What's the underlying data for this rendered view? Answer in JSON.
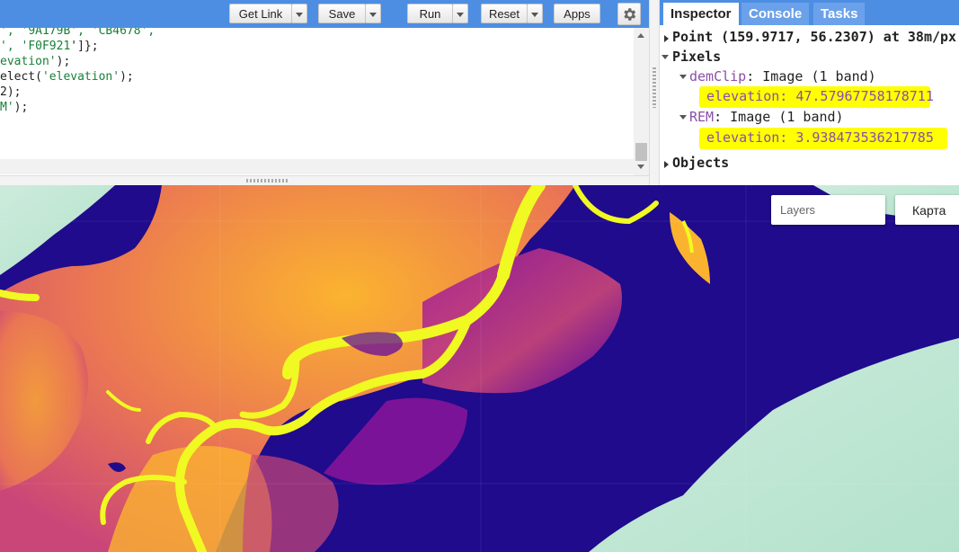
{
  "toolbar": {
    "get_link": "Get Link",
    "save": "Save",
    "run": "Run",
    "reset": "Reset",
    "apps": "Apps"
  },
  "code": {
    "line1_a": "', '",
    "line1_b": "9A179B",
    "line1_c": "', '",
    "line1_d": "CB4678",
    "line1_e": "',",
    "line2_a": "', '",
    "line2_b": "F0F921",
    "line2_c": "']};",
    "line3_a": "evation'",
    "line3_b": ");",
    "line4_a": "elect(",
    "line4_b": "'elevation'",
    "line4_c": ");",
    "line5": "2);",
    "line6_a": "M'",
    "line6_b": ");"
  },
  "tabs": {
    "inspector": "Inspector",
    "console": "Console",
    "tasks": "Tasks"
  },
  "inspector": {
    "point": "Point (159.9717, 56.2307) at 38m/px",
    "pixels": "Pixels",
    "dem_name": "demClip",
    "dem_desc": ": Image (1 band)",
    "dem_value": "elevation: 47.57967758178711",
    "rem_name": "REM",
    "rem_desc": ": Image (1 band)",
    "rem_value": "elevation: 3.938473536217785",
    "objects": "Objects"
  },
  "map": {
    "layers": "Layers",
    "map_type": "Карта"
  },
  "colors": {
    "toolbar_blue": "#4d8ee3",
    "highlight": "#ffff00",
    "palette": [
      "#0D0887",
      "#5B02A3",
      "#9A179B",
      "#CB4678",
      "#EB7852",
      "#FBB32F",
      "#F0F921"
    ]
  }
}
